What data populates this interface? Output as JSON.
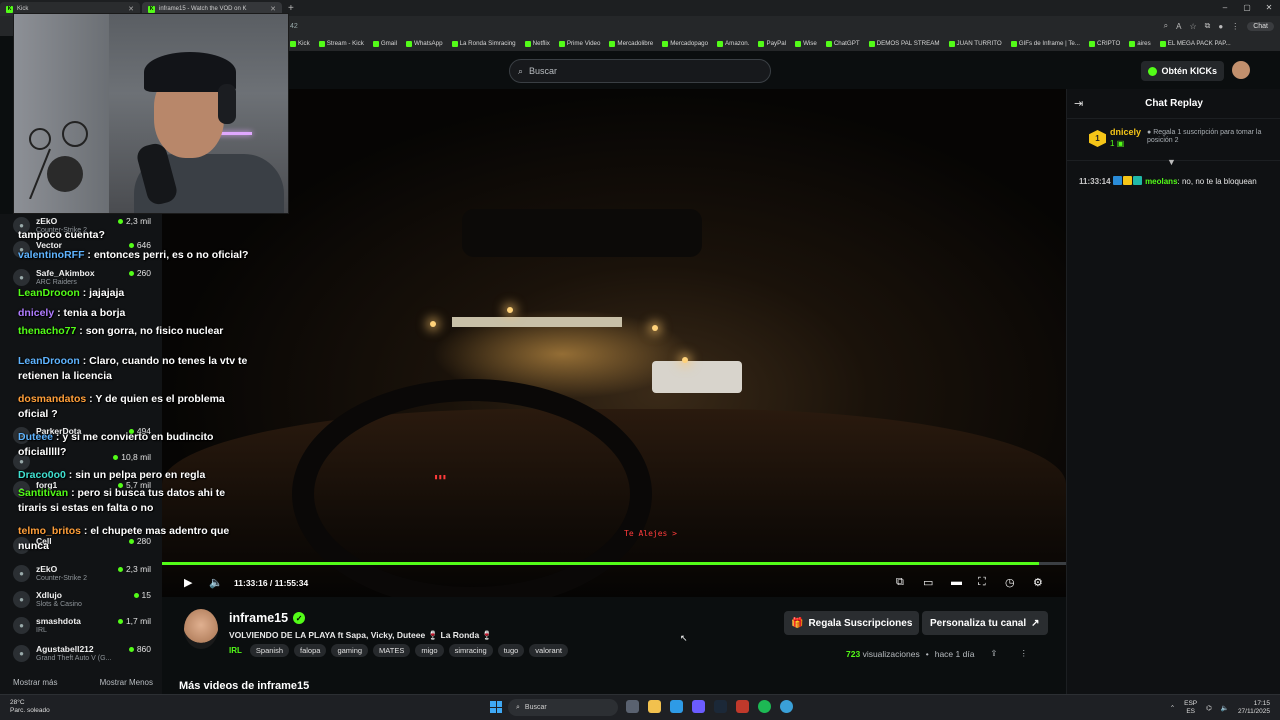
{
  "browser": {
    "tabs": [
      {
        "label": "Kick",
        "active": false
      },
      {
        "label": "inframe15 - Watch the VOD on K",
        "active": true
      }
    ],
    "url_fragment": "42",
    "chat_pill": "Chat",
    "bookmarks": [
      "Kick",
      "Stream - Kick",
      "Gmail",
      "WhatsApp",
      "La Ronda Simracing",
      "Netflix",
      "Prime Video",
      "Mercadolibre",
      "Mercadopago",
      "Amazon.",
      "PayPal",
      "Wise",
      "ChatGPT",
      "DEMOS PAL STREAM",
      "JUAN TURRITO",
      "GIFs de Inframe | Te...",
      "CRIPTO",
      "aires",
      "EL MEGA PACK PAP..."
    ]
  },
  "header": {
    "search_placeholder": "Buscar",
    "kicks_button": "Obtén KICKs"
  },
  "sidebar": {
    "channels": [
      {
        "name": "zEkO",
        "category": "Counter-Strike 2",
        "viewers": "2,3 mil"
      },
      {
        "name": "Vector",
        "category": "",
        "viewers": "646"
      },
      {
        "name": "Safe_Akimbox",
        "category": "ARC Raiders",
        "viewers": "260"
      },
      {
        "name": "ParkerDota",
        "category": "",
        "viewers": "494"
      },
      {
        "name": "",
        "category": "",
        "viewers": "10,8 mil"
      },
      {
        "name": "forg1",
        "category": "",
        "viewers": "5,7 mil"
      },
      {
        "name": "Cell",
        "category": "",
        "viewers": "280"
      },
      {
        "name": "zEkO",
        "category": "Counter-Strike 2",
        "viewers": "2,3 mil"
      },
      {
        "name": "Xdlujo",
        "category": "Slots & Casino",
        "viewers": "15"
      },
      {
        "name": "smashdota",
        "category": "IRL",
        "viewers": "1,7 mil"
      },
      {
        "name": "Agustabell212",
        "category": "Grand Theft Auto V (G...",
        "viewers": "860"
      }
    ],
    "show_more": "Mostrar más",
    "show_less": "Mostrar Menos"
  },
  "chat_overlay": [
    {
      "user": "",
      "text": "tampoco cuenta?",
      "color": "#ffffff"
    },
    {
      "user": "valentinoRFF",
      "text": " : entonces perri, es o no oficial?",
      "color": "#5fb4ff"
    },
    {
      "user": "LeanDrooon",
      "text": " : jajajaja",
      "color": "#53fc18"
    },
    {
      "user": "dnicely",
      "text": " : tenia a borja",
      "color": "#b07cff"
    },
    {
      "user": "thenacho77",
      "text": " : son gorra, no fisico nuclear",
      "color": "#53fc18"
    },
    {
      "user": "LeanDrooon",
      "text": " : Claro, cuando no tenes la vtv te retienen la licencia",
      "color": "#5fb4ff"
    },
    {
      "user": "dosmandatos",
      "text": " : Y de quien es el problema oficial ?",
      "color": "#ff9f3a"
    },
    {
      "user": "Duteee",
      "text": " : y si me convierto en budincito oficialllll?",
      "color": "#5fb4ff"
    },
    {
      "user": "Draco0o0",
      "text": " : sin un pelpa pero en regla",
      "color": "#40e0d0"
    },
    {
      "user": "Santitivan",
      "text": " : pero si busca tus datos ahi te tiraris si estas en falta o no",
      "color": "#53fc18"
    },
    {
      "user": "telmo_britos",
      "text": " : el chupete mas adentro que nunca",
      "color": "#ff9f3a"
    }
  ],
  "video": {
    "current_time": "11:33:16",
    "duration": "11:55:34",
    "progress_fraction": 0.97,
    "overlay_text": "Te Alejes >"
  },
  "chat_panel": {
    "title": "Chat Replay",
    "pinned": {
      "rank": "1",
      "user": "dnicely",
      "count": "1",
      "note": "Regala 1 suscripción para tomar la posición 2"
    },
    "messages": [
      {
        "time": "11:33:14",
        "user": "meolans",
        "text": ": no, no te la bloquean"
      }
    ]
  },
  "channel": {
    "name": "inframe15",
    "title": "VOLVIENDO DE LA PLAYA ft Sapa, Vicky, Duteee 🍷 La Ronda 🍷",
    "category": "IRL",
    "tags": [
      "Spanish",
      "falopa",
      "gaming",
      "MATES",
      "migo",
      "simracing",
      "tugo",
      "valorant"
    ],
    "gift_button": "Regala Suscripciones",
    "customize_button": "Personaliza tu canal",
    "views": "723",
    "views_label": "visualizaciones",
    "age": "hace 1 día",
    "more_videos": "Más videos de inframe15"
  },
  "taskbar": {
    "weather_temp": "28°C",
    "weather_desc": "Parc. soleado",
    "search": "Buscar",
    "lang": "ESP",
    "lang2": "ES",
    "time": "17:15",
    "date": "27/11/2025"
  }
}
